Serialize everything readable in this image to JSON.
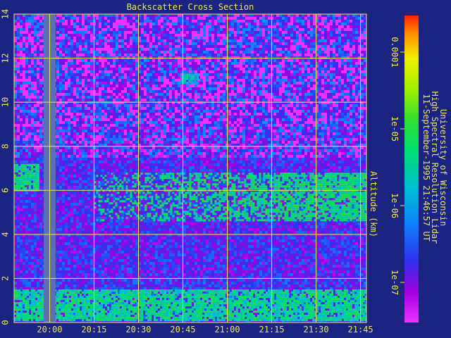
{
  "chart_data": {
    "type": "heatmap",
    "title": "Backscatter Cross Section",
    "ylabel": "Altitude (km)",
    "xlabel": "",
    "x_ticks": [
      "20:00",
      "20:15",
      "20:30",
      "20:45",
      "21:00",
      "21:15",
      "21:30",
      "21:45"
    ],
    "x_range": [
      "19:48",
      "21:47"
    ],
    "y_ticks": [
      0,
      2,
      4,
      6,
      8,
      10,
      12,
      14
    ],
    "ylim": [
      0,
      14
    ],
    "grid": true,
    "colorbar": {
      "scale": "log",
      "range": [
        3e-08,
        0.0003
      ],
      "tick_labels": [
        "1e-07",
        "1e-06",
        "1e-05",
        "0.0001"
      ],
      "tick_values": [
        1e-07,
        1e-06,
        1e-05,
        0.0001
      ]
    },
    "data_gap": {
      "start": "19:58",
      "end": "20:02"
    },
    "features": [
      {
        "name": "boundary-layer",
        "altitude_km": [
          0.1,
          1.5
        ],
        "time": [
          "19:48",
          "21:47"
        ],
        "backscatter": 3e-06
      },
      {
        "name": "cirrus-layer",
        "altitude_km": [
          4.6,
          6.8
        ],
        "time": [
          "20:15",
          "21:47"
        ],
        "backscatter": 4e-06
      },
      {
        "name": "early-layer",
        "altitude_km": [
          6.0,
          7.2
        ],
        "time": [
          "19:48",
          "19:56"
        ],
        "backscatter": 4e-06
      },
      {
        "name": "high-wisp",
        "altitude_km": [
          10.9,
          11.3
        ],
        "time": [
          "20:44",
          "20:50"
        ],
        "backscatter": 1.5e-06
      }
    ],
    "colors": {
      "background": "#1c2481",
      "axis": "#f0e84a",
      "gap": "#5a6fb4"
    }
  },
  "annotation": [
    "University of Wisconsin",
    "High Spectral Resolution Lidar",
    "11-September-1995 21:46:57 UT"
  ]
}
